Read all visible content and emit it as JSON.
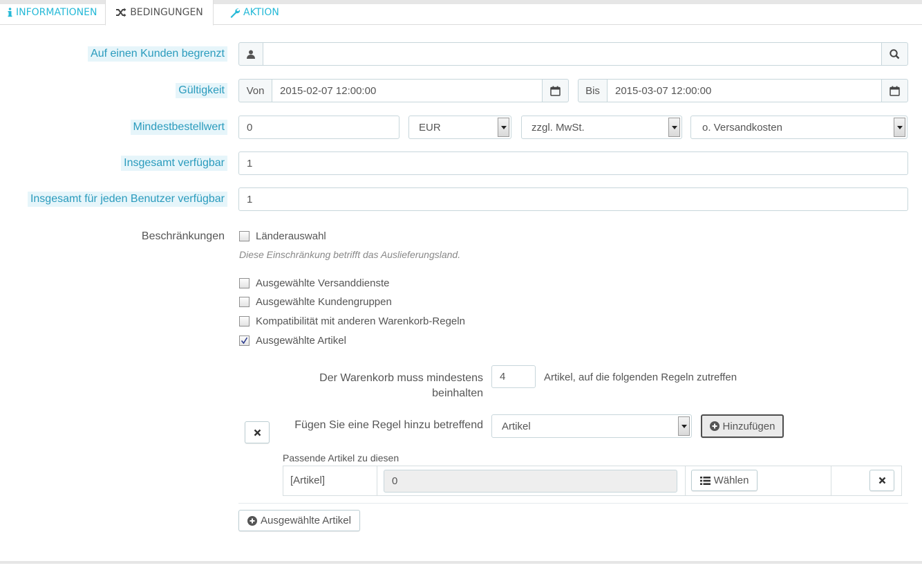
{
  "tabs": [
    {
      "label": "Informationen",
      "icon": "info-icon"
    },
    {
      "label": "Bedingungen",
      "icon": "shuffle-icon",
      "active": true
    },
    {
      "label": "Aktion",
      "icon": "wrench-icon"
    }
  ],
  "customer": {
    "label": "Auf einen Kunden begrenzt",
    "value": "",
    "user_icon": "user-icon",
    "search_icon": "search-icon"
  },
  "validity": {
    "label": "Gültigkeit",
    "from_label": "Von",
    "from_value": "2015-02-07 12:00:00",
    "to_label": "Bis",
    "to_value": "2015-03-07 12:00:00",
    "calendar_icon": "calendar-icon"
  },
  "min_order": {
    "label": "Mindestbestellwert",
    "value": "0",
    "currency": "EUR",
    "tax": "zzgl. MwSt.",
    "shipping": "o. Versandkosten"
  },
  "total_available": {
    "label": "Insgesamt verfügbar",
    "value": "1"
  },
  "per_user": {
    "label": "Insgesamt für jeden Benutzer verfügbar",
    "value": "1"
  },
  "restrictions": {
    "label": "Beschränkungen",
    "country": {
      "label": "Länderauswahl",
      "checked": false
    },
    "country_hint": "Diese Einschränkung betrifft das Auslieferungsland.",
    "items": [
      {
        "label": "Ausgewählte Versanddienste",
        "checked": false
      },
      {
        "label": "Ausgewählte Kundengruppen",
        "checked": false
      },
      {
        "label": "Kompatibilität mit anderen Warenkorb-Regeln",
        "checked": false
      },
      {
        "label": "Ausgewählte Artikel",
        "checked": true
      }
    ]
  },
  "product_rule": {
    "cart_label_line1": "Der Warenkorb muss mindestens",
    "cart_label_line2": "beinhalten",
    "quantity": "4",
    "suffix": "Artikel, auf die folgenden Regeln zutreffen",
    "add_rule_label": "Fügen Sie eine Regel hinzu betreffend",
    "rule_type": "Artikel",
    "add_button": "Hinzufügen",
    "matching_label": "Passende Artikel zu diesen",
    "row": {
      "type": "[Artikel]",
      "count": "0",
      "choose_button": "Wählen"
    }
  },
  "add_selected_button": "Ausgewählte Artikel",
  "colors": {
    "accent": "#25b9d7",
    "label_bg": "#e6f5fa",
    "border": "#c7d6db"
  }
}
